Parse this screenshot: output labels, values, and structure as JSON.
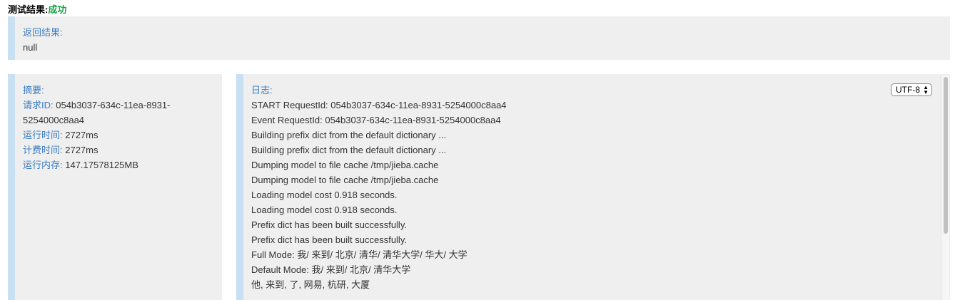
{
  "result": {
    "title": "测试结果:",
    "status": "成功"
  },
  "return_panel": {
    "label": "返回结果:",
    "value": "null"
  },
  "summary": {
    "label": "摘要:",
    "request_id_label": "请求ID:",
    "request_id_value": " 054b3037-634c-11ea-8931-5254000c8aa4",
    "run_time_label": "运行时间:",
    "run_time_value": " 2727ms",
    "billing_time_label": "计费时间:",
    "billing_time_value": " 2727ms",
    "memory_label": "运行内存:",
    "memory_value": " 147.17578125MB"
  },
  "log": {
    "label": "日志:",
    "encoding": "UTF-8",
    "lines": [
      "START RequestId: 054b3037-634c-11ea-8931-5254000c8aa4",
      "Event RequestId: 054b3037-634c-11ea-8931-5254000c8aa4",
      "Building prefix dict from the default dictionary ...",
      "Building prefix dict from the default dictionary ...",
      "Dumping model to file cache /tmp/jieba.cache",
      "Dumping model to file cache /tmp/jieba.cache",
      "Loading model cost 0.918 seconds.",
      "Loading model cost 0.918 seconds.",
      "Prefix dict has been built successfully.",
      "Prefix dict has been built successfully.",
      "Full Mode: 我/ 来到/ 北京/ 清华/ 清华大学/ 华大/ 大学",
      "Default Mode: 我/ 来到/ 北京/ 清华大学",
      "他, 来到, 了, 网易, 杭研, 大厦"
    ]
  }
}
